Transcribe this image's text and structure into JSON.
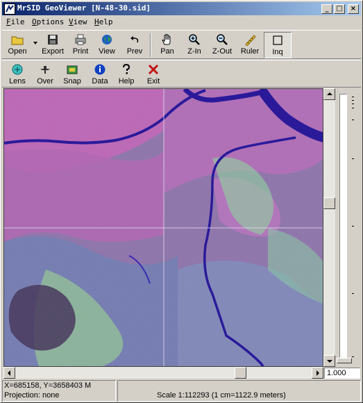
{
  "window": {
    "title": "MrSID GeoViewer  [N-48-30.sid]",
    "controls": {
      "minimize": "_",
      "maximize": "□",
      "close": "×"
    }
  },
  "menu": [
    {
      "label": "File",
      "hotkey": "F",
      "rest": "ile"
    },
    {
      "label": "Options",
      "hotkey": "O",
      "rest": "ptions"
    },
    {
      "label": "View",
      "hotkey": "V",
      "rest": "iew"
    },
    {
      "label": "Help",
      "hotkey": "H",
      "rest": "elp"
    }
  ],
  "toolbar1": {
    "open": "Open",
    "export": "Export",
    "print": "Print",
    "view": "View",
    "prev": "Prev",
    "pan": "Pan",
    "zin": "Z-In",
    "zout": "Z-Out",
    "ruler": "Ruler",
    "inq": "Inq"
  },
  "toolbar2": {
    "lens": "Lens",
    "over": "Over",
    "snap": "Snap",
    "data": "Data",
    "help": "Help",
    "exit": "Exit"
  },
  "zoom": {
    "value": "1.000"
  },
  "status": {
    "coords": "X=685158, Y=3658403 M",
    "projection": "Projection: none",
    "scale": "Scale 1:112293 (1 cm=1122.9 meters)"
  },
  "colors": {
    "title_start": "#0a246a",
    "title_end": "#a6caf0",
    "chrome": "#d4d0c8",
    "map_base": "#8a6aa0",
    "river": "#2a1a9a",
    "vegetation": "#7ad48a",
    "urban": "#d04ab0"
  },
  "icons": {
    "open": "folder-icon",
    "export": "floppy-icon",
    "print": "printer-icon",
    "view": "globe-icon",
    "prev": "undo-arrow-icon",
    "pan": "hand-icon",
    "zin": "zoom-in-icon",
    "zout": "zoom-out-icon",
    "ruler": "ruler-icon",
    "inq": "inquire-icon",
    "lens": "lens-icon",
    "over": "overview-icon",
    "snap": "snapshot-icon",
    "data": "info-icon",
    "help": "question-icon",
    "exit": "close-x-icon"
  }
}
